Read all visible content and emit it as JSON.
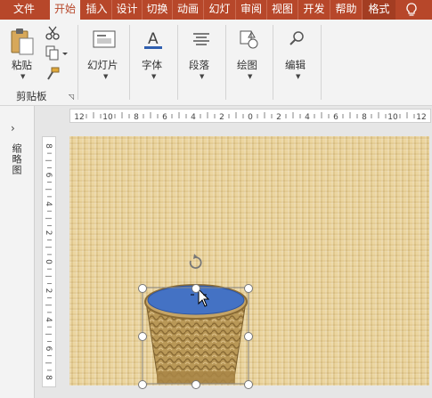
{
  "tabs": [
    {
      "label": "文件",
      "active": false
    },
    {
      "label": "开始",
      "active": true
    },
    {
      "label": "插入",
      "active": false
    },
    {
      "label": "设计",
      "active": false
    },
    {
      "label": "切换",
      "active": false
    },
    {
      "label": "动画",
      "active": false
    },
    {
      "label": "幻灯",
      "active": false
    },
    {
      "label": "审阅",
      "active": false
    },
    {
      "label": "视图",
      "active": false
    },
    {
      "label": "开发",
      "active": false
    },
    {
      "label": "帮助",
      "active": false
    },
    {
      "label": "格式",
      "active": false
    }
  ],
  "ribbon": {
    "paste_label": "粘贴",
    "clipboard_group": "剪贴板",
    "slides_label": "幻灯片",
    "font_label": "字体",
    "paragraph_label": "段落",
    "drawing_label": "绘图",
    "editing_label": "编辑"
  },
  "sidepane": {
    "label": "缩略图"
  },
  "ruler": {
    "h_ticks": [
      "12",
      "10",
      "8",
      "6",
      "4",
      "2",
      "0",
      "2",
      "4",
      "6",
      "8",
      "10",
      "12"
    ],
    "v_ticks": [
      "8",
      "6",
      "4",
      "2",
      "0",
      "2",
      "4",
      "6",
      "8"
    ]
  },
  "colors": {
    "accent": "#b7472a",
    "ellipse_fill": "#4472c4",
    "slide_bg": "#e7cf96"
  },
  "icons": [
    "paste-icon",
    "cut-icon",
    "copy-icon",
    "format-painter-icon",
    "slides-icon",
    "font-icon",
    "paragraph-icon",
    "drawing-icon",
    "editing-icon",
    "lightbulb-icon",
    "rotate-icon",
    "move-cursor-icon"
  ]
}
